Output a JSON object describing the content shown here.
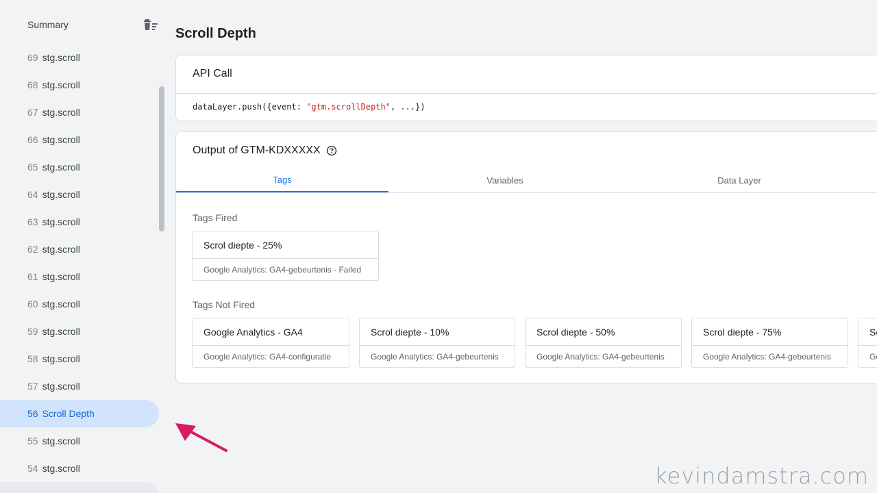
{
  "sidebar": {
    "summary_label": "Summary",
    "events": [
      {
        "num": "69",
        "label": "stg.scroll"
      },
      {
        "num": "68",
        "label": "stg.scroll"
      },
      {
        "num": "67",
        "label": "stg.scroll"
      },
      {
        "num": "66",
        "label": "stg.scroll"
      },
      {
        "num": "65",
        "label": "stg.scroll"
      },
      {
        "num": "64",
        "label": "stg.scroll"
      },
      {
        "num": "63",
        "label": "stg.scroll"
      },
      {
        "num": "62",
        "label": "stg.scroll"
      },
      {
        "num": "61",
        "label": "stg.scroll"
      },
      {
        "num": "60",
        "label": "stg.scroll"
      },
      {
        "num": "59",
        "label": "stg.scroll"
      },
      {
        "num": "58",
        "label": "stg.scroll"
      },
      {
        "num": "57",
        "label": "stg.scroll"
      },
      {
        "num": "56",
        "label": "Scroll Depth"
      },
      {
        "num": "55",
        "label": "stg.scroll"
      },
      {
        "num": "54",
        "label": "stg.scroll"
      }
    ],
    "selected_index": 13
  },
  "main": {
    "title": "Scroll Depth",
    "api_call": {
      "title": "API Call",
      "code_prefix": "dataLayer.push({event: ",
      "code_string": "\"gtm.scrollDepth\"",
      "code_suffix": ", ...})"
    },
    "output": {
      "title": "Output of GTM-KDXXXXX",
      "tabs": [
        "Tags",
        "Variables",
        "Data Layer"
      ],
      "active_tab": "Tags",
      "tags_fired_label": "Tags Fired",
      "tags_fired": [
        {
          "name": "Scrol diepte - 25%",
          "type": "Google Analytics: GA4-gebeurtenis - Failed"
        }
      ],
      "tags_not_fired_label": "Tags Not Fired",
      "tags_not_fired": [
        {
          "name": "Google Analytics - GA4",
          "type": "Google Analytics: GA4-configuratie"
        },
        {
          "name": "Scrol diepte - 10%",
          "type": "Google Analytics: GA4-gebeurtenis"
        },
        {
          "name": "Scrol diepte - 50%",
          "type": "Google Analytics: GA4-gebeurtenis"
        },
        {
          "name": "Scrol diepte - 75%",
          "type": "Google Analytics: GA4-gebeurtenis"
        },
        {
          "name": "Sc",
          "type": "Go"
        }
      ]
    }
  },
  "watermark": "kevindamstra.com",
  "colors": {
    "accent": "#1a73e8",
    "selected_bg": "#d2e3fc",
    "arrow": "#d81b60"
  }
}
